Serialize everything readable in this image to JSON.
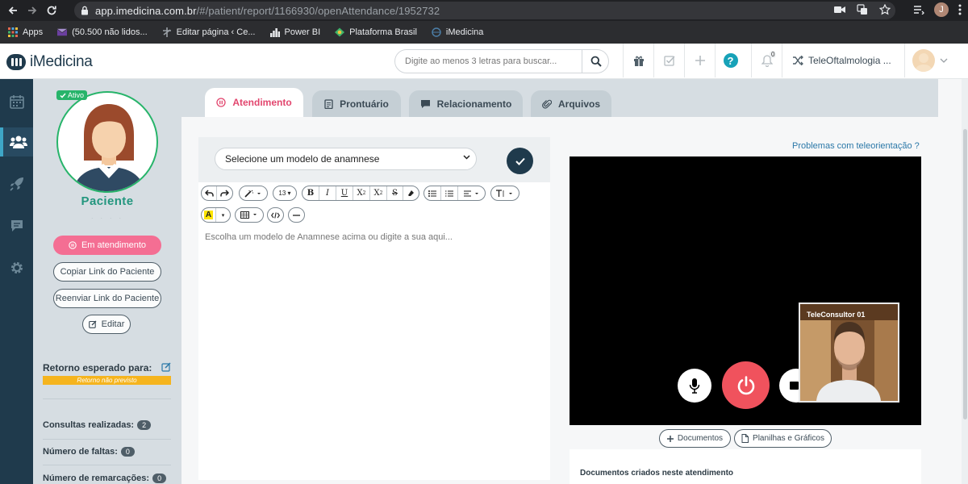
{
  "browser": {
    "url_host": "app.imedicina.com.br",
    "url_path": "/#/patient/report/1166930/openAttendance/1952732",
    "profile_initial": "J",
    "bookmarks": [
      {
        "label": "Apps",
        "icon": "apps-grid-icon"
      },
      {
        "label": "(50.500 não lidos...",
        "icon": "mail-icon"
      },
      {
        "label": "Editar página ‹ Ce...",
        "icon": "wordpress-icon"
      },
      {
        "label": "Power BI",
        "icon": "power-bi-icon"
      },
      {
        "label": "Plataforma Brasil",
        "icon": "plataforma-brasil-icon"
      },
      {
        "label": "iMedicina",
        "icon": "globe-icon"
      }
    ]
  },
  "header": {
    "logo": "iMedicina",
    "search_placeholder": "Digite ao menos 3 letras para buscar...",
    "notifications_count": "0",
    "help_glyph": "?",
    "tele_menu": "TeleOftalmologia ..."
  },
  "sidebar": {
    "items": [
      {
        "name": "calendar-icon",
        "active": false
      },
      {
        "name": "patients-icon",
        "active": true
      },
      {
        "name": "rocket-icon",
        "active": false
      },
      {
        "name": "chat-icon",
        "active": false
      },
      {
        "name": "settings-icon",
        "active": false
      }
    ]
  },
  "patient": {
    "status_badge": "Ativo",
    "name": "Paciente",
    "subtitle": "· ·  · ·",
    "btn_attending": "Em atendimento",
    "btn_copy_link": "Copiar Link do Paciente",
    "btn_resend_link": "Reenviar Link do Paciente",
    "btn_edit": "Editar",
    "return_label": "Retorno esperado para:",
    "return_value": "Retorno não previsto",
    "stats": [
      {
        "label": "Consultas realizadas:",
        "count": "2"
      },
      {
        "label": "Número de faltas:",
        "count": "0"
      },
      {
        "label": "Número de remarcações:",
        "count": "0"
      }
    ]
  },
  "tabs": [
    {
      "label": "Atendimento",
      "active": true,
      "icon": "pause-circle-icon"
    },
    {
      "label": "Prontuário",
      "active": false,
      "icon": "clipboard-icon"
    },
    {
      "label": "Relacionamento",
      "active": false,
      "icon": "chat-icon"
    },
    {
      "label": "Arquivos",
      "active": false,
      "icon": "paperclip-icon"
    }
  ],
  "editor": {
    "model_select_value": "Selecione um modelo de anamnese",
    "font_size": "13",
    "placeholder": "Escolha um modelo de Anamnese acima ou digite a sua aqui..."
  },
  "video": {
    "problems_link": "Problemas com teleorientação ?",
    "self_label": "TeleConsultor 01"
  },
  "documents": {
    "btn_docs": "Documentos",
    "btn_sheets": "Planilhas e Gráficos",
    "created_title": "Documentos criados neste atendimento"
  },
  "colors": {
    "navy": "#1f3a4c",
    "accent_pink": "#f46e93",
    "active_tab_pink": "#e2466e",
    "status_green": "#27b46a",
    "end_call_red": "#f0525d",
    "warning_orange": "#f5b41e"
  }
}
